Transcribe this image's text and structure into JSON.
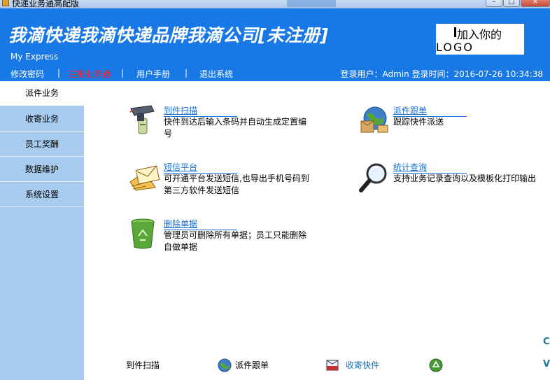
{
  "window": {
    "title": "快递业务通高配版",
    "minimize": "–",
    "maximize": "□",
    "close": "×"
  },
  "header": {
    "company": "我滴快递我滴快递品牌我滴公司[未注册]",
    "subtitle": "My Express",
    "logo_line1": "加入你的",
    "logo_line2": "LOGO",
    "nav": {
      "change_password": "修改密码",
      "register": "注册业务通",
      "manual": "用户手册",
      "logout": "退出系统",
      "separator": "|"
    },
    "login_info": "登录用户：Admin  登录时间：2016-07-26 10:34:38"
  },
  "sidebar": {
    "items": [
      {
        "label": "派件业务"
      },
      {
        "label": "收寄业务"
      },
      {
        "label": "员工奖酬"
      },
      {
        "label": "数据维护"
      },
      {
        "label": "系统设置"
      }
    ]
  },
  "features": [
    {
      "title": "到件扫描",
      "desc": "快件到达后输入条码并自动生成定置编号",
      "icon": "barcode-scanner-icon"
    },
    {
      "title": "派件跟单",
      "desc": "跟踪快件派送",
      "icon": "globe-delivery-icon"
    },
    {
      "title": "短信平台",
      "desc": "可开通平台发送短信,也导出手机号码到第三方软件发送短信",
      "icon": "envelope-hand-icon"
    },
    {
      "title": "统计查询",
      "desc": "支持业务记录查询以及模板化打印输出",
      "icon": "magnifier-icon"
    },
    {
      "title": "删除单据",
      "desc": "管理员可删除所有单据；员工只能删除自做单据",
      "icon": "recycle-bin-icon"
    }
  ],
  "bottom_bar": {
    "scan": "到件扫描",
    "track": "派件跟单",
    "receive": "收寄快件"
  },
  "edge_chars": [
    "C",
    "V"
  ],
  "colors": {
    "header_bg": "#1878e6",
    "sidebar_bg": "#a7ccf0",
    "link": "#1a6fd1",
    "nav_highlight": "#ff2020"
  }
}
